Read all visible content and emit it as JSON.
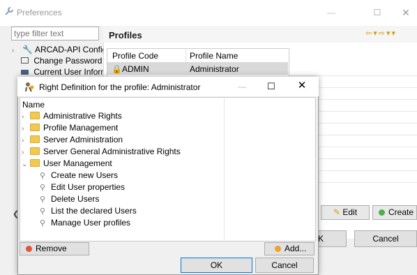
{
  "back_window": {
    "title": "Preferences",
    "filter_placeholder": "type filter text",
    "tree": [
      "ARCAD-API Config",
      "Change Password",
      "Current User Inforn"
    ],
    "panel_title": "Profiles",
    "table": {
      "columns": [
        "Profile Code",
        "Profile Name"
      ],
      "rows": [
        {
          "code": "ADMIN",
          "name": "Administrator"
        }
      ]
    },
    "edit_label": "Edit",
    "create_label": "Create",
    "ok_label": "K",
    "cancel_label": "Cancel"
  },
  "dialog": {
    "title": "Right Definition for the profile: Administrator",
    "column_header": "Name",
    "groups": [
      {
        "label": "Administrative Rights",
        "expanded": false
      },
      {
        "label": "Profile Management",
        "expanded": false
      },
      {
        "label": "Server Administration",
        "expanded": false
      },
      {
        "label": "Server General Administrative Rights",
        "expanded": false
      },
      {
        "label": "User Management",
        "expanded": true
      }
    ],
    "user_management_children": [
      "Create new Users",
      "Edit User properties",
      "Delete Users",
      "List the declared Users",
      "Manage User profiles"
    ],
    "remove_label": "Remove",
    "add_label": "Add...",
    "ok_label": "OK",
    "cancel_label": "Cancel"
  },
  "colors": {
    "accent": "#0078d7",
    "folder": "#f2c94c",
    "remove_icon": "#e0553a",
    "add_icon": "#f0a030",
    "create_icon": "#4caf50"
  }
}
